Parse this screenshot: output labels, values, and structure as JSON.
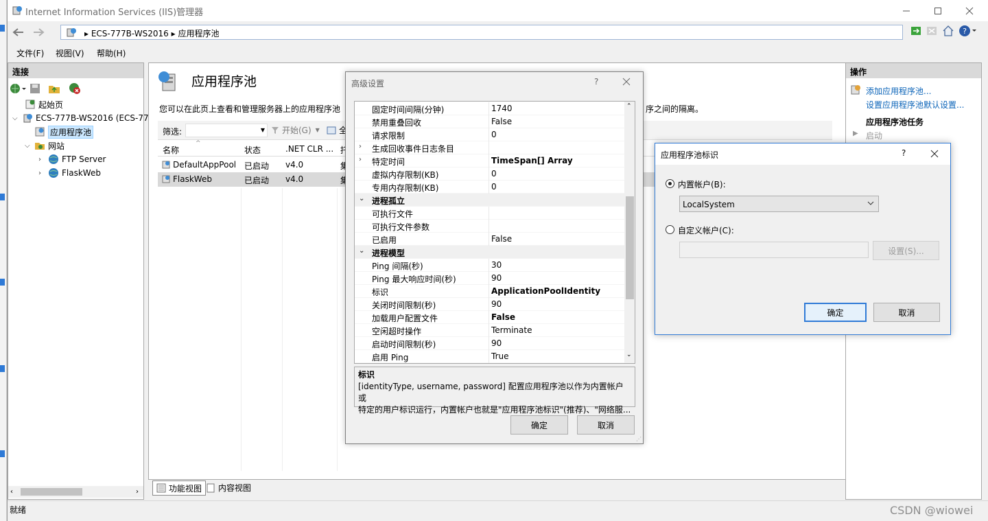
{
  "window": {
    "title": "Internet Information Services (IIS)管理器",
    "address": {
      "segments": [
        "ECS-777B-WS2016",
        "应用程序池"
      ]
    },
    "menu": [
      "文件(F)",
      "视图(V)",
      "帮助(H)"
    ]
  },
  "connections": {
    "header": "连接",
    "tree": [
      {
        "label": "起始页",
        "level": 0
      },
      {
        "label": "ECS-777B-WS2016 (ECS-77",
        "level": 0
      },
      {
        "label": "应用程序池",
        "level": 1,
        "selected": true
      },
      {
        "label": "网站",
        "level": 1
      },
      {
        "label": "FTP Server",
        "level": 2
      },
      {
        "label": "FlaskWeb",
        "level": 2
      }
    ]
  },
  "center": {
    "title": "应用程序池",
    "description": "您可以在此页上查看和管理服务器上的应用程序池",
    "description_tail": "序之间的隔离。",
    "filter_label": "筛选:",
    "start_label": "开始(G)",
    "show_all": "全",
    "columns": [
      "名称",
      "状态",
      ".NET CLR ...",
      "托"
    ],
    "rows": [
      {
        "name": "DefaultAppPool",
        "status": "已启动",
        "clr": "v4.0",
        "mode": "集"
      },
      {
        "name": "FlaskWeb",
        "status": "已启动",
        "clr": "v4.0",
        "mode": "集"
      }
    ],
    "view_tabs": [
      "功能视图",
      "内容视图"
    ]
  },
  "actions": {
    "header": "操作",
    "add_pool": "添加应用程序池...",
    "set_defaults": "设置应用程序池默认设置...",
    "tasks_title": "应用程序池任务",
    "start": "启动"
  },
  "status": {
    "text": "就绪",
    "watermark": "CSDN @wiowei"
  },
  "advanced_dialog": {
    "title": "高级设置",
    "help": "?",
    "rows": [
      {
        "name": "固定时间间隔(分钟)",
        "value": "1740"
      },
      {
        "name": "禁用重叠回收",
        "value": "False"
      },
      {
        "name": "请求限制",
        "value": "0"
      },
      {
        "name": "生成回收事件日志条目",
        "value": "",
        "expander": ">"
      },
      {
        "name": "特定时间",
        "value": "TimeSpan[] Array",
        "bold": true,
        "expander": ">"
      },
      {
        "name": "虚拟内存限制(KB)",
        "value": "0"
      },
      {
        "name": "专用内存限制(KB)",
        "value": "0"
      },
      {
        "name": "进程孤立",
        "category": true,
        "expander": "v"
      },
      {
        "name": "可执行文件",
        "value": ""
      },
      {
        "name": "可执行文件参数",
        "value": ""
      },
      {
        "name": "已启用",
        "value": "False"
      },
      {
        "name": "进程模型",
        "category": true,
        "expander": "v"
      },
      {
        "name": "Ping 间隔(秒)",
        "value": "30"
      },
      {
        "name": "Ping 最大响应时间(秒)",
        "value": "90"
      },
      {
        "name": "标识",
        "value": "ApplicationPoolIdentity",
        "bold": true
      },
      {
        "name": "关闭时间限制(秒)",
        "value": "90"
      },
      {
        "name": "加载用户配置文件",
        "value": "False",
        "bold": true
      },
      {
        "name": "空闲超时操作",
        "value": "Terminate"
      },
      {
        "name": "启动时间限制(秒)",
        "value": "90"
      },
      {
        "name": "启用 Ping",
        "value": "True"
      }
    ],
    "desc_title": "标识",
    "desc_line1": "[identityType, username, password] 配置应用程序池以作为内置帐户或",
    "desc_line2": "特定的用户标识运行，内置帐户也就是\"应用程序池标识\"(推荐)、\"网络服...",
    "ok": "确定",
    "cancel": "取消"
  },
  "identity_dialog": {
    "title": "应用程序池标识",
    "help": "?",
    "builtin_label": "内置帐户(B):",
    "builtin_selected": "LocalSystem",
    "custom_label": "自定义帐户(C):",
    "custom_value": "",
    "set_button": "设置(S)...",
    "ok": "确定",
    "cancel": "取消"
  }
}
